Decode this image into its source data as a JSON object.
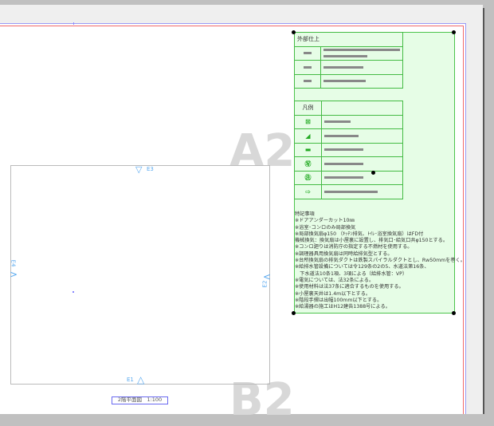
{
  "drawing": {
    "watermark_top": "A2",
    "watermark_bottom": "B2",
    "view_title": "2階平面図　1:100"
  },
  "elevation_markers": {
    "top": "E3",
    "right": "E2",
    "bottom": "E1",
    "left": "E4"
  },
  "finish_table": {
    "header": "外部仕上",
    "rows": 3
  },
  "legend_table": {
    "header": "凡例",
    "symbols": [
      "⊠",
      "◢",
      "▬",
      "㊢",
      "㊟",
      "⇨"
    ]
  },
  "notes": {
    "title": "特記事項",
    "lines": [
      "※ドアアンダーカット10㎜",
      "※浴室･コンロのみ局部換気",
      "※局部換気扇φ150 （ｷｯﾁﾝ排気、ﾄｲﾚ･浴室換気扇）はFD付",
      "機械換気：換気扇は小屋裏に設置し、排気口･給気口共φ150とする。",
      "※コンロ廻りは消防庁の指定する不燃材を使用する。",
      "※調理器具用換気扇は同時給排気型とする。",
      "※台所換気扇の排気ダクトは鉄製スパイラルダクトとし、Rw50mmを巻く。",
      "※給排水管設備については令129条の2の5、水道法第16条、",
      "　下水道法10条1項、3項による（給排水管：VP）",
      "※電気については、法32条による。",
      "※使用材料は法37条に適合するものを使用する。",
      "※小屋裏天井は1.4m以下とする。",
      "※階段手摺は出幅100mm以下とする。",
      "※給湯器の施工はH12建告1388号による。"
    ]
  }
}
